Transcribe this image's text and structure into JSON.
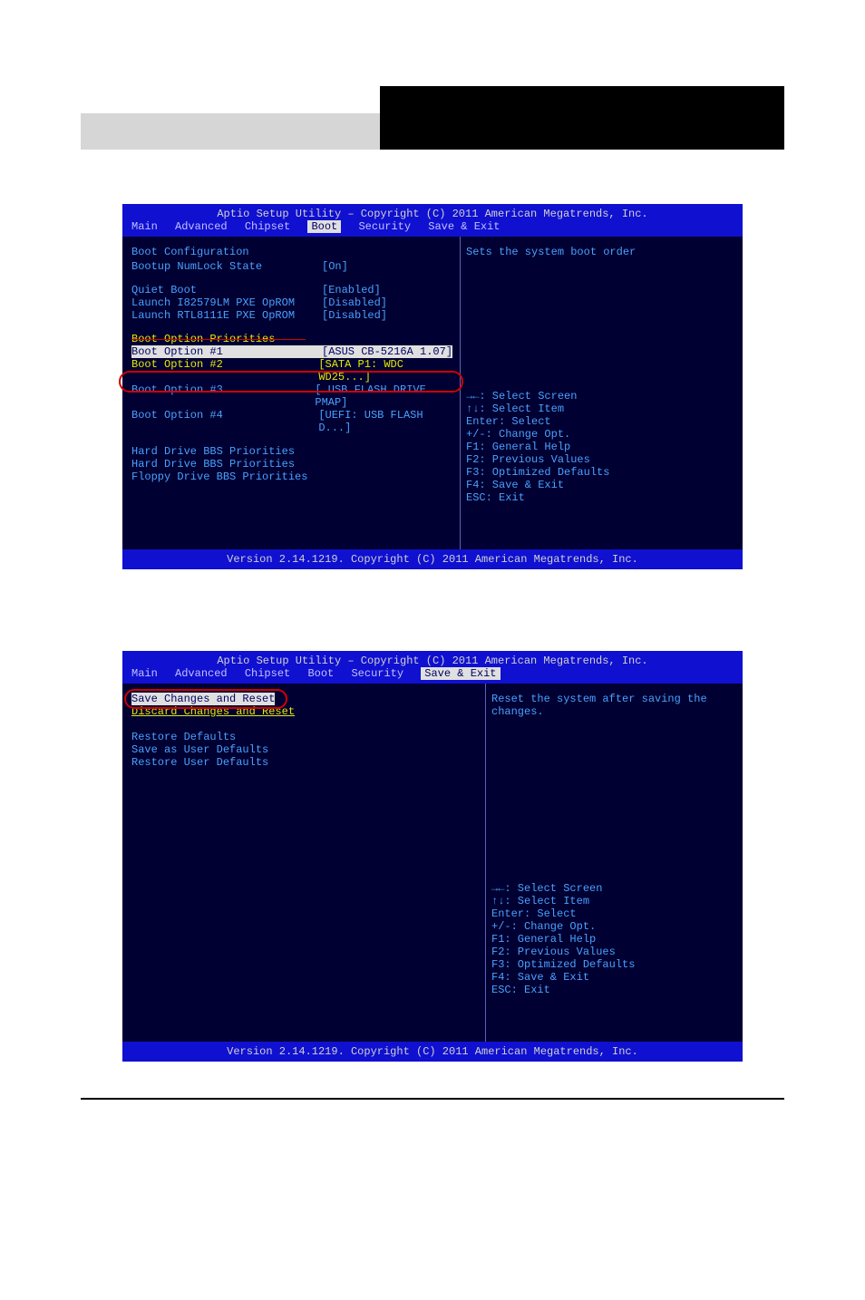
{
  "bios1": {
    "title": "Aptio Setup Utility – Copyright (C) 2011 American Megatrends, Inc.",
    "menu": {
      "items": [
        "Main",
        "Advanced",
        "Chipset",
        "Boot",
        "Security",
        "Save & Exit"
      ],
      "active": "Boot"
    },
    "sections": {
      "config_title": "Boot Configuration",
      "numlock": {
        "label": "Bootup NumLock State",
        "value": "[On]"
      },
      "quiet": {
        "label": "Quiet Boot",
        "value": "[Enabled]"
      },
      "pxe1": {
        "label": "Launch I82579LM PXE OpROM",
        "value": "[Disabled]"
      },
      "pxe2": {
        "label": "Launch RTL8111E PXE OpROM",
        "value": "[Disabled]"
      },
      "prio_title": "Boot Option Priorities",
      "opt1": {
        "label": "Boot Option #1",
        "value": "[ASUS CB-5216A 1.07]"
      },
      "opt2": {
        "label": "Boot Option #2",
        "value": "[SATA  P1: WDC WD25...]"
      },
      "opt3": {
        "label": "Boot Option #3",
        "value": "[ USB FLASH DRIVE PMAP]"
      },
      "opt4": {
        "label": "Boot Option #4",
        "value": "[UEFI:  USB FLASH D...]"
      },
      "bbs1": "Hard Drive BBS Priorities",
      "bbs2": "Hard Drive BBS Priorities",
      "bbs3": "Floppy Drive BBS Priorities"
    },
    "help_top": "Sets the system boot order",
    "help_keys": {
      "l1": "→←: Select Screen",
      "l2": "↑↓: Select Item",
      "l3": "Enter: Select",
      "l4": "+/-: Change Opt.",
      "l5": "F1: General Help",
      "l6": "F2: Previous Values",
      "l7": "F3: Optimized Defaults",
      "l8": "F4: Save & Exit",
      "l9": "ESC: Exit"
    },
    "footer": "Version 2.14.1219. Copyright (C) 2011 American Megatrends, Inc."
  },
  "bios2": {
    "title": "Aptio Setup Utility – Copyright (C) 2011 American Megatrends, Inc.",
    "menu": {
      "items": [
        "Main",
        "Advanced",
        "Chipset",
        "Boot",
        "Security",
        "Save & Exit"
      ],
      "active": "Save & Exit"
    },
    "items": {
      "save_reset": "Save Changes and Reset",
      "discard_reset": "Discard Changes and Reset",
      "restore_def": "Restore Defaults",
      "save_user_def": "Save as User Defaults",
      "restore_user_def": "Restore User Defaults"
    },
    "help_top": "Reset the system after saving the changes.",
    "help_keys": {
      "l1": "→←: Select Screen",
      "l2": "↑↓: Select Item",
      "l3": "Enter: Select",
      "l4": "+/-: Change Opt.",
      "l5": "F1: General Help",
      "l6": "F2: Previous Values",
      "l7": "F3: Optimized Defaults",
      "l8": "F4: Save & Exit",
      "l9": "ESC: Exit"
    },
    "footer": "Version 2.14.1219. Copyright (C) 2011 American Megatrends, Inc."
  }
}
